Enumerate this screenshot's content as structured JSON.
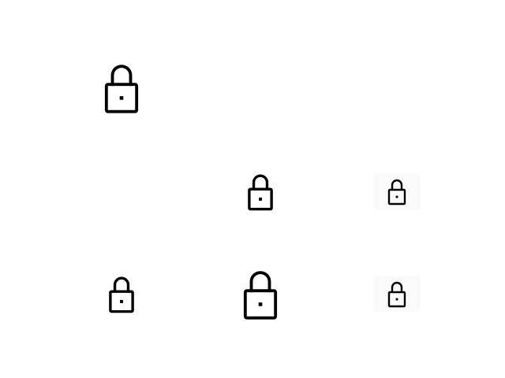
{
  "icons": [
    {
      "name": "lock-icon",
      "color": "#000000"
    },
    {
      "name": "lock-icon",
      "color": "#000000"
    },
    {
      "name": "lock-icon",
      "color": "#000000"
    },
    {
      "name": "lock-icon",
      "color": "#000000"
    },
    {
      "name": "lock-icon",
      "color": "#000000"
    },
    {
      "name": "lock-icon",
      "color": "#000000"
    }
  ],
  "colors": {
    "background": "#ffffff",
    "tile_background": "#fafafa",
    "icon_stroke": "#000000"
  }
}
